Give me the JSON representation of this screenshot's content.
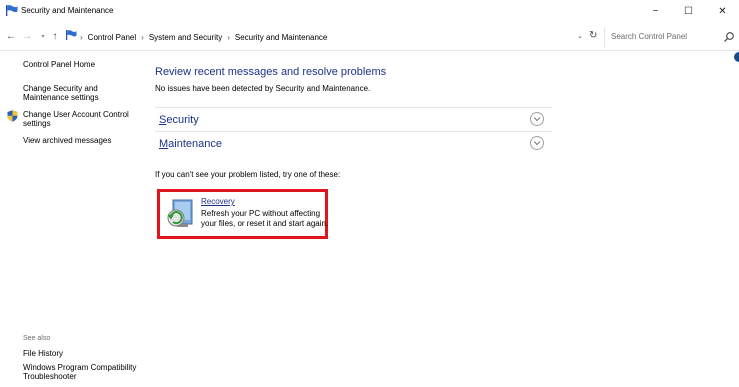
{
  "window": {
    "title": "Security and Maintenance",
    "minimize_glyph": "−",
    "maximize_glyph": "☐",
    "close_glyph": "✕"
  },
  "nav": {
    "back_glyph": "←",
    "forward_glyph": "→",
    "recent_glyph": "▾",
    "up_glyph": "↑",
    "breadcrumb": [
      "Control Panel",
      "System and Security",
      "Security and Maintenance"
    ],
    "separator": "›",
    "dropdown_glyph": "⌄",
    "refresh_glyph": "↻"
  },
  "search": {
    "placeholder": "Search Control Panel"
  },
  "left_pane": {
    "home": "Control Panel Home",
    "change_security": "Change Security and Maintenance settings",
    "change_uac": "Change User Account Control settings",
    "view_archived": "View archived messages",
    "see_also": "See also",
    "file_history": "File History",
    "troubleshooter": "Windows Program Compatibility Troubleshooter"
  },
  "main": {
    "heading": "Review recent messages and resolve problems",
    "status": "No issues have been detected by Security and Maintenance.",
    "sections": [
      {
        "first": "S",
        "rest": "ecurity"
      },
      {
        "first": "M",
        "rest": "aintenance"
      }
    ],
    "hint": "If you can't see your problem listed, try one of these:",
    "recovery": {
      "title": "Recovery",
      "description": "Refresh your PC without affecting your files, or reset it and start again."
    }
  },
  "colors": {
    "heading_blue": "#1e3287",
    "highlight_red": "#e0141d"
  }
}
